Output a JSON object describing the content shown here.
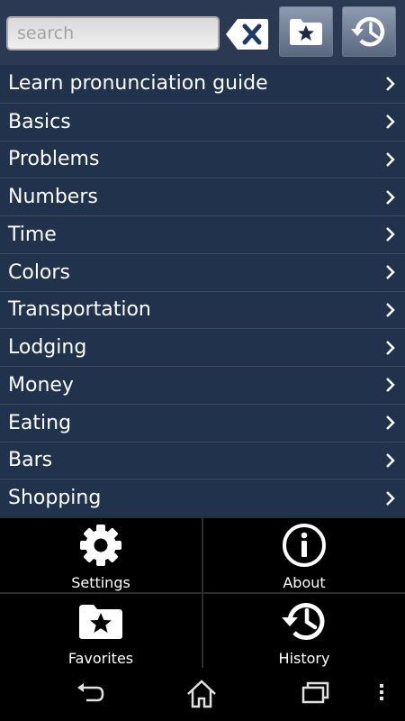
{
  "search": {
    "placeholder": "search",
    "value": ""
  },
  "toolbar": {
    "clear_icon": "backspace-x-icon",
    "favorites_icon": "star-folder-icon",
    "history_icon": "history-clock-icon"
  },
  "categories": [
    {
      "label": "Learn pronunciation guide"
    },
    {
      "label": "Basics"
    },
    {
      "label": "Problems"
    },
    {
      "label": "Numbers"
    },
    {
      "label": "Time"
    },
    {
      "label": "Colors"
    },
    {
      "label": "Transportation"
    },
    {
      "label": "Lodging"
    },
    {
      "label": "Money"
    },
    {
      "label": "Eating"
    },
    {
      "label": "Bars"
    },
    {
      "label": "Shopping"
    }
  ],
  "bottom_menu": {
    "settings": {
      "label": "Settings",
      "icon": "gear-icon"
    },
    "about": {
      "label": "About",
      "icon": "info-icon"
    },
    "favorites": {
      "label": "Favorites",
      "icon": "star-folder-icon"
    },
    "history": {
      "label": "History",
      "icon": "history-clock-icon"
    }
  },
  "navbar": {
    "back_icon": "back-icon",
    "home_icon": "home-icon",
    "recent_icon": "recent-apps-icon",
    "menu_icon": "overflow-menu-icon"
  },
  "colors": {
    "list_background": "#21324d",
    "topbar_background": "#2b3a52",
    "bottom_background": "#000000"
  }
}
